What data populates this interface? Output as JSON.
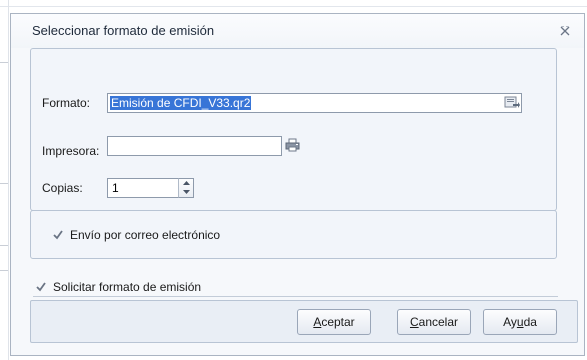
{
  "dialog": {
    "title": "Seleccionar formato de emisión",
    "close_icon": "close-x-icon"
  },
  "form": {
    "formato": {
      "label": "Formato:",
      "value": "Emisión de CFDI_V33.qr2",
      "button_icon": "browse-file-icon"
    },
    "impresora": {
      "label": "Impresora:",
      "value": "",
      "button_icon": "printer-icon"
    },
    "copias": {
      "label": "Copias:",
      "value": "1"
    }
  },
  "options": {
    "envio_correo": {
      "label": "Envío por correo electrónico",
      "checked": true
    },
    "solicitar_formato": {
      "label": "Solicitar formato de emisión",
      "checked": true
    }
  },
  "buttons": {
    "aceptar": {
      "mnemonic": "A",
      "rest": "ceptar"
    },
    "cancelar": {
      "mnemonic": "C",
      "rest": "ancelar"
    },
    "ayuda": {
      "pre": "Ay",
      "mnemonic": "u",
      "rest": "da"
    }
  },
  "colors": {
    "selection": "#3875d7",
    "border": "#8e9aab",
    "panel": "#f2f5fa"
  }
}
